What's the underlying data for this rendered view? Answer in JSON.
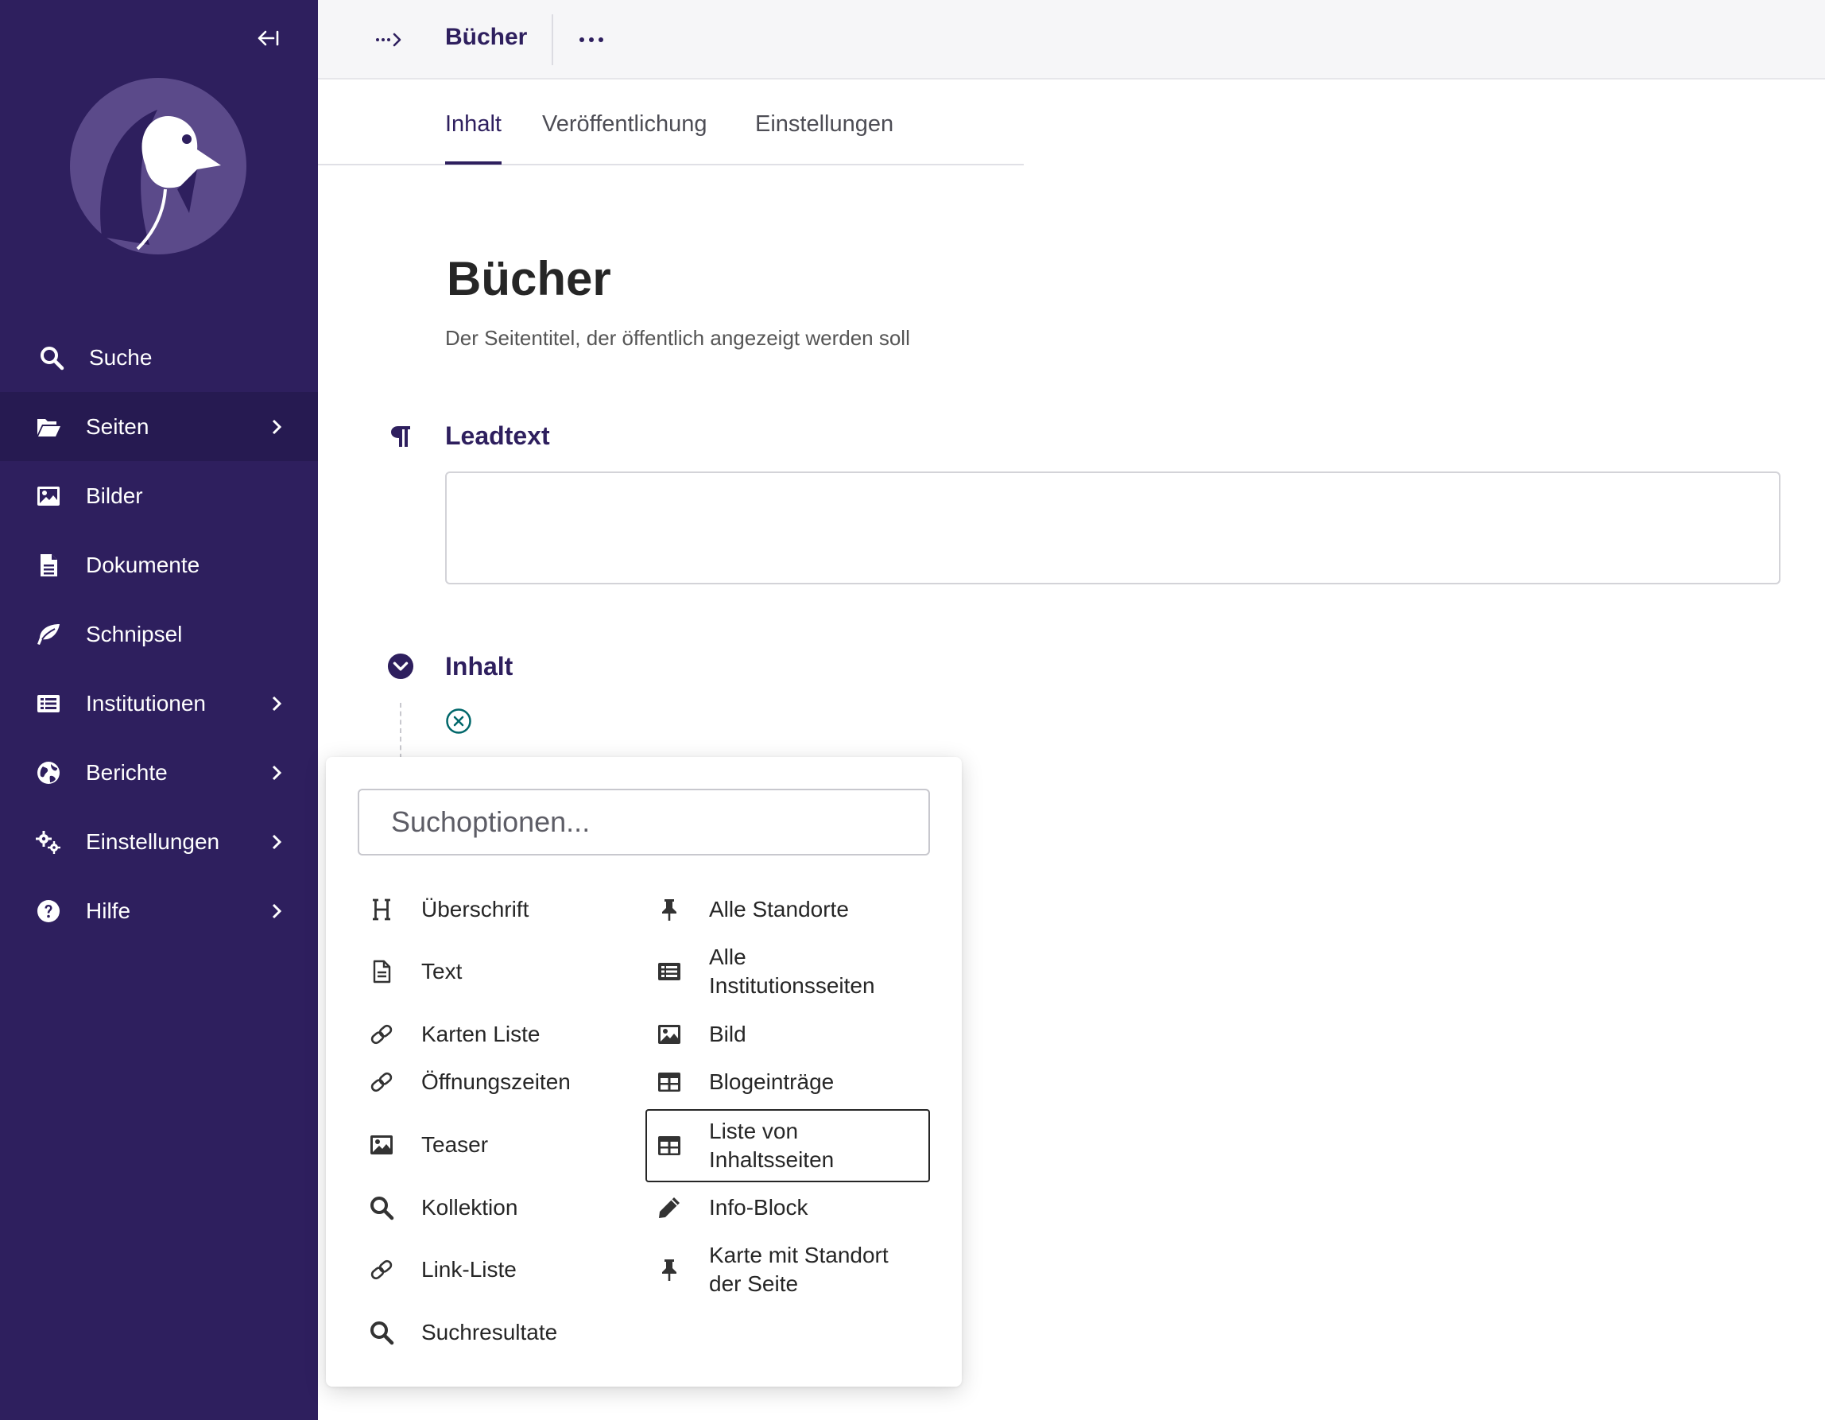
{
  "sidebar": {
    "collapse_label": "←I",
    "items": [
      {
        "label": "Suche",
        "icon": "search-icon"
      },
      {
        "label": "Seiten",
        "icon": "folder-open-icon"
      },
      {
        "label": "Bilder",
        "icon": "image-icon"
      },
      {
        "label": "Dokumente",
        "icon": "document-icon"
      },
      {
        "label": "Schnipsel",
        "icon": "snippet-icon"
      },
      {
        "label": "Institutionen",
        "icon": "list-icon"
      },
      {
        "label": "Berichte",
        "icon": "globe-icon"
      },
      {
        "label": "Einstellungen",
        "icon": "cogs-icon"
      },
      {
        "label": "Hilfe",
        "icon": "help-icon"
      }
    ]
  },
  "header": {
    "breadcrumb_toggle": "···>",
    "title": "Bücher"
  },
  "tabs": [
    {
      "label": "Inhalt",
      "active": true
    },
    {
      "label": "Veröffentlichung",
      "active": false
    },
    {
      "label": "Einstellungen",
      "active": false
    }
  ],
  "page": {
    "title": "Bücher",
    "title_help": "Der Seitentitel, der öffentlich angezeigt werden soll"
  },
  "fields": {
    "leadtext_label": "Leadtext",
    "content_label": "Inhalt"
  },
  "chooser": {
    "search_placeholder": "Suchoptionen...",
    "left": [
      {
        "label": "Überschrift",
        "icon": "heading-icon"
      },
      {
        "label": "Text",
        "icon": "doc-outline-icon"
      },
      {
        "label": "Karten Liste",
        "icon": "link-icon"
      },
      {
        "label": "Öffnungszeiten",
        "icon": "link-icon"
      },
      {
        "label": "Teaser",
        "icon": "image-icon"
      },
      {
        "label": "Kollektion",
        "icon": "search-icon"
      },
      {
        "label": "Link-Liste",
        "icon": "link-icon"
      },
      {
        "label": "Suchresultate",
        "icon": "search-icon"
      }
    ],
    "right": [
      {
        "label": "Alle Standorte",
        "icon": "pin-icon"
      },
      {
        "label": "Alle Institutionsseiten",
        "icon": "list-icon"
      },
      {
        "label": "Bild",
        "icon": "image-icon"
      },
      {
        "label": "Blogeinträge",
        "icon": "table-icon"
      },
      {
        "label": "Liste von Inhaltsseiten",
        "icon": "table-icon"
      },
      {
        "label": "Info-Block",
        "icon": "pencil-icon"
      },
      {
        "label": "Karte mit Standort der Seite",
        "icon": "pin-icon"
      }
    ]
  },
  "colors": {
    "sidebar": "#2e1f5e",
    "sidebar_active": "#261a51",
    "accent": "#2e1f5e",
    "teal": "#00676a"
  }
}
